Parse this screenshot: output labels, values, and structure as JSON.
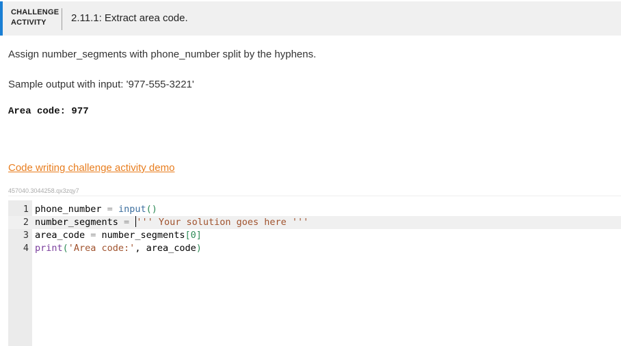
{
  "header": {
    "badge_line1": "CHALLENGE",
    "badge_line2": "ACTIVITY",
    "title": "2.11.1: Extract area code.",
    "accent_color": "#1a7fd4"
  },
  "instruction": "Assign number_segments with phone_number split by the hyphens.",
  "sample_label": "Sample output with input: '977-555-3221'",
  "sample_output": "Area code: 977",
  "demo_link": "Code writing challenge activity demo",
  "activity_id": "457040.3044258.qx3zqy7",
  "editor": {
    "lines": [
      {
        "num": "1",
        "tokens": [
          {
            "t": "phone_number ",
            "c": ""
          },
          {
            "t": "=",
            "c": "t-op"
          },
          {
            "t": " ",
            "c": ""
          },
          {
            "t": "input",
            "c": "t-builtin"
          },
          {
            "t": "()",
            "c": "t-paren"
          }
        ]
      },
      {
        "num": "2",
        "tokens": [
          {
            "t": "number_segments ",
            "c": ""
          },
          {
            "t": "=",
            "c": "t-op"
          },
          {
            "t": " ",
            "c": ""
          },
          {
            "t": "''' Your solution goes here '''",
            "c": "t-str"
          }
        ]
      },
      {
        "num": "3",
        "tokens": [
          {
            "t": "area_code ",
            "c": ""
          },
          {
            "t": "=",
            "c": "t-op"
          },
          {
            "t": " number_segments",
            "c": ""
          },
          {
            "t": "[",
            "c": "t-paren"
          },
          {
            "t": "0",
            "c": "t-num"
          },
          {
            "t": "]",
            "c": "t-paren"
          }
        ]
      },
      {
        "num": "4",
        "tokens": [
          {
            "t": "print",
            "c": "t-builtin2"
          },
          {
            "t": "(",
            "c": "t-paren"
          },
          {
            "t": "'Area code:'",
            "c": "t-str"
          },
          {
            "t": ", area_code",
            "c": ""
          },
          {
            "t": ")",
            "c": "t-paren"
          }
        ]
      }
    ]
  }
}
